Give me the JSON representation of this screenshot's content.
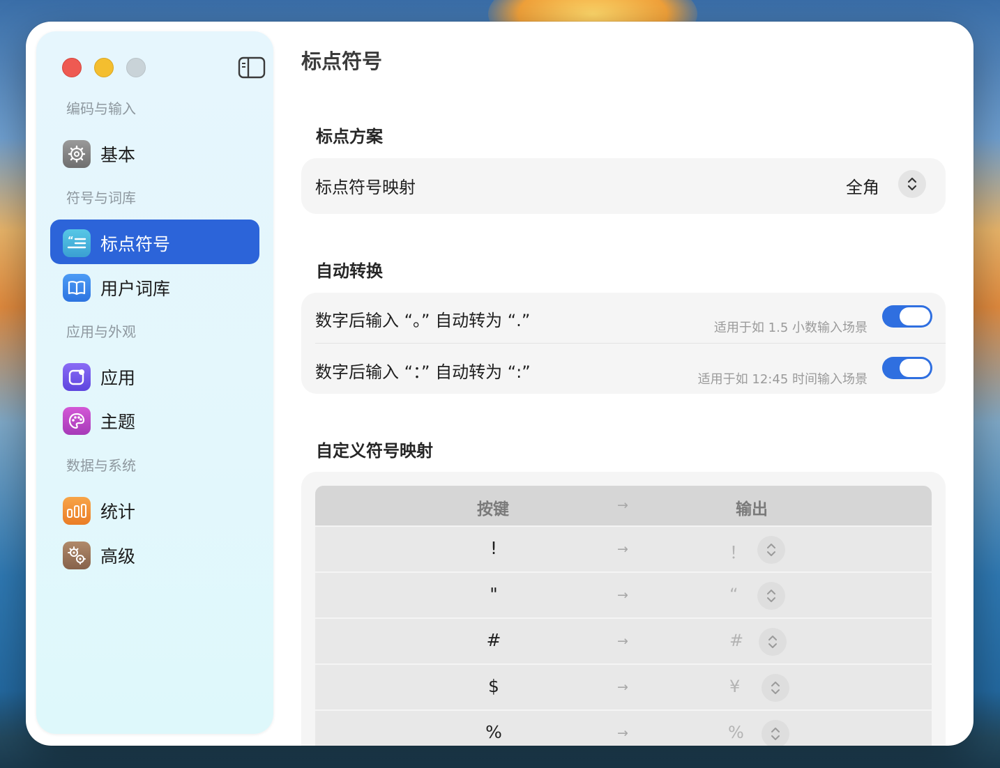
{
  "window": {
    "title": "标点符号"
  },
  "sidebar": {
    "sections": [
      {
        "title": "编码与输入",
        "items": [
          {
            "label": "基本",
            "icon": "gear-icon",
            "active": false
          }
        ]
      },
      {
        "title": "符号与词库",
        "items": [
          {
            "label": "标点符号",
            "icon": "quote-list-icon",
            "active": true
          },
          {
            "label": "用户词库",
            "icon": "book-icon",
            "active": false
          }
        ]
      },
      {
        "title": "应用与外观",
        "items": [
          {
            "label": "应用",
            "icon": "app-square-icon",
            "active": false
          },
          {
            "label": "主题",
            "icon": "palette-icon",
            "active": false
          }
        ]
      },
      {
        "title": "数据与系统",
        "items": [
          {
            "label": "统计",
            "icon": "bar-chart-icon",
            "active": false
          },
          {
            "label": "高级",
            "icon": "gears-icon",
            "active": false
          }
        ]
      }
    ]
  },
  "main": {
    "scheme": {
      "title": "标点方案",
      "row_label": "标点符号映射",
      "value": "全角"
    },
    "auto": {
      "title": "自动转换",
      "rows": [
        {
          "label": "数字后输入 “。” 自动转为 “.”",
          "hint": "适用于如 1.5 小数输入场景",
          "on": true
        },
        {
          "label": "数字后输入 “：” 自动转为 “:”",
          "hint": "适用于如 12:45 时间输入场景",
          "on": true
        }
      ]
    },
    "custom": {
      "title": "自定义符号映射",
      "header": {
        "key": "按键",
        "arrow": "→",
        "output": "输出"
      },
      "rows": [
        {
          "key": "!",
          "arrow": "→",
          "output": "！"
        },
        {
          "key": "\"",
          "arrow": "→",
          "output": "“"
        },
        {
          "key": "#",
          "arrow": "→",
          "output": "#"
        },
        {
          "key": "$",
          "arrow": "→",
          "output": "¥"
        },
        {
          "key": "%",
          "arrow": "→",
          "output": "%"
        }
      ]
    }
  },
  "colors": {
    "accent": "#2c64d9",
    "toggle_on": "#2f6fe0"
  }
}
